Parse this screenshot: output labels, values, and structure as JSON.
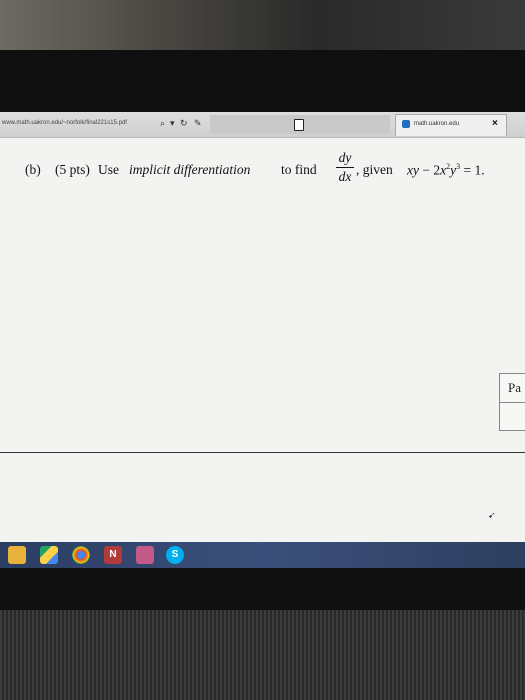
{
  "browser": {
    "url": "www.math.uakron.edu/~norfolk/final221s15.pdf",
    "tab_title": "math.uakron.edu",
    "search_icon": "search-icon",
    "refresh_icon": "refresh-icon",
    "close_symbol": "×"
  },
  "problem": {
    "label": "(b)",
    "points": "(5 pts)",
    "use": "Use",
    "emphasis": "implicit differentiation",
    "to_find": "to find",
    "frac_num": "dy",
    "frac_den": "dx",
    "given": ", given",
    "equation_xy": "xy",
    "equation_mid": " − 2",
    "equation_x": "x",
    "exp1": "2",
    "equation_y": "y",
    "exp2": "3",
    "equation_rhs": " = 1."
  },
  "side_box": {
    "text": "Pa"
  },
  "taskbar": {
    "icons": [
      "folder-icon",
      "drive-icon",
      "chrome-icon",
      "onenote-icon",
      "store-icon",
      "skype-icon"
    ],
    "onenote_letter": "N",
    "skype_letter": "S"
  }
}
